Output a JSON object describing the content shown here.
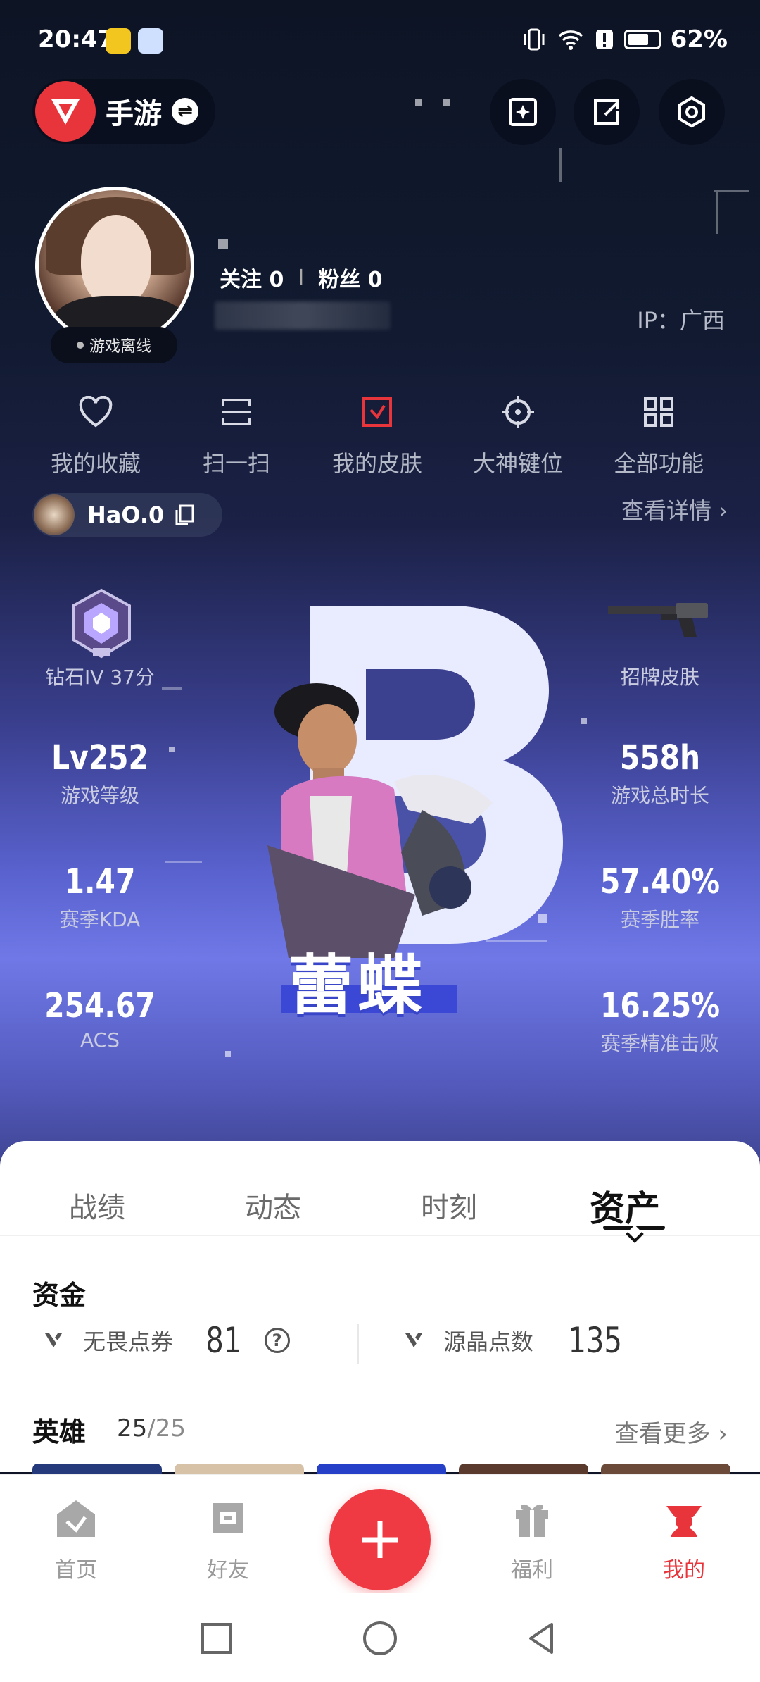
{
  "status_bar": {
    "time": "20:47",
    "battery": "62%"
  },
  "header": {
    "mode_label": "手游"
  },
  "profile": {
    "offline_label": "游戏离线",
    "follow_label": "关注",
    "follow_count": "0",
    "divider": "I",
    "fans_label": "粉丝",
    "fans_count": "0",
    "ip_label": "IP：广西"
  },
  "functions": [
    {
      "label": "我的收藏",
      "icon": "heart-icon"
    },
    {
      "label": "扫一扫",
      "icon": "scan-icon"
    },
    {
      "label": "我的皮肤",
      "icon": "skin-icon",
      "accent": "#e8343b"
    },
    {
      "label": "大神键位",
      "icon": "crosshair-icon"
    },
    {
      "label": "全部功能",
      "icon": "grid-icon"
    }
  ],
  "account": {
    "name": "HaO.0",
    "detail_link": "查看详情"
  },
  "stats": {
    "rank_label": "钻石IV 37分",
    "skin_label": "招牌皮肤",
    "level_value": "Lv252",
    "level_label": "游戏等级",
    "hours_value": "558h",
    "hours_label": "游戏总时长",
    "kda_value": "1.47",
    "kda_label": "赛季KDA",
    "winrate_value": "57.40%",
    "winrate_label": "赛季胜率",
    "acs_value": "254.67",
    "acs_label": "ACS",
    "precision_value": "16.25%",
    "precision_label": "赛季精准击败",
    "agent_name": "蕾蝶"
  },
  "tabs": [
    {
      "label": "战绩"
    },
    {
      "label": "动态"
    },
    {
      "label": "时刻"
    },
    {
      "label": "资产",
      "active": true
    }
  ],
  "assets": {
    "title": "资金",
    "vp_label": "无畏点券",
    "vp_value": "81",
    "help": "?",
    "rp_label": "源晶点数",
    "rp_value": "135"
  },
  "heroes": {
    "title": "英雄",
    "owned": "25",
    "slash": "/",
    "total": "25",
    "more_link": "查看更多"
  },
  "tabbar": [
    {
      "label": "首页",
      "icon": "home-icon"
    },
    {
      "label": "好友",
      "icon": "friends-icon"
    },
    {
      "label": "福利",
      "icon": "gift-icon"
    },
    {
      "label": "我的",
      "icon": "profile-icon",
      "active": true
    }
  ],
  "colors": {
    "accent": "#e8343b",
    "hero_blue": "#6f78e6",
    "active_text": "#111111"
  }
}
